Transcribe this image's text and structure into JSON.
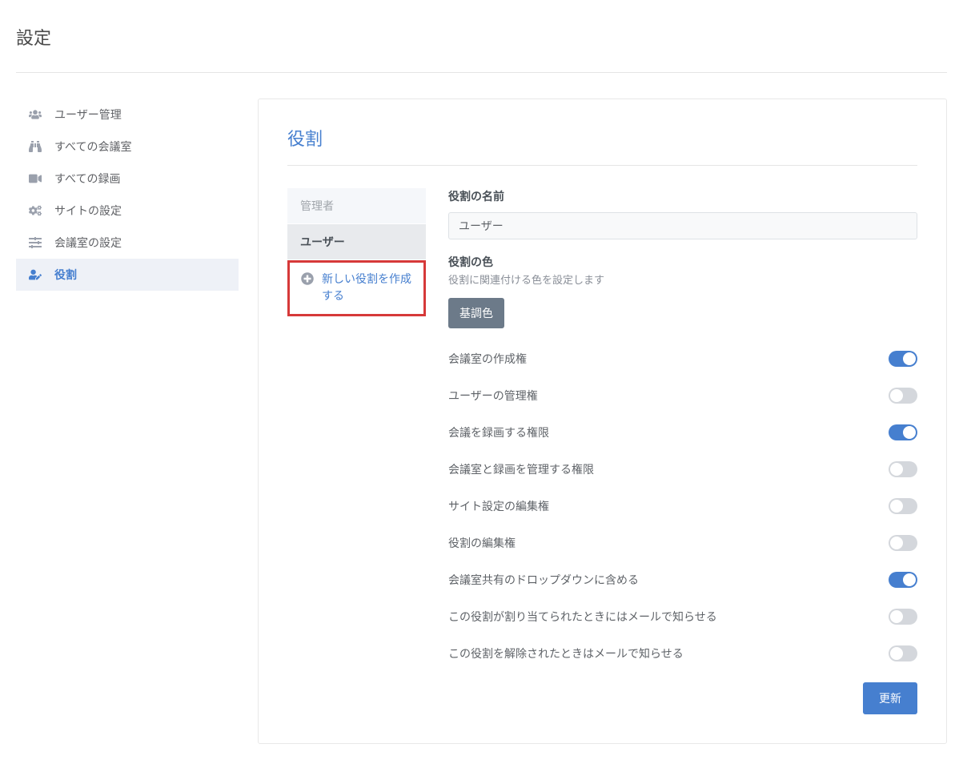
{
  "page": {
    "title": "設定"
  },
  "sidebar": {
    "items": [
      {
        "label": "ユーザー管理",
        "icon": "users-icon"
      },
      {
        "label": "すべての会議室",
        "icon": "binoculars-icon"
      },
      {
        "label": "すべての録画",
        "icon": "video-icon"
      },
      {
        "label": "サイトの設定",
        "icon": "cogs-icon"
      },
      {
        "label": "会議室の設定",
        "icon": "sliders-icon"
      },
      {
        "label": "役割",
        "icon": "user-edit-icon"
      }
    ]
  },
  "panel": {
    "title": "役割",
    "roleTabs": {
      "admin": "管理者",
      "user": "ユーザー",
      "createNew": "新しい役割を作成する"
    },
    "form": {
      "nameLabel": "役割の名前",
      "nameValue": "ユーザー",
      "colorLabel": "役割の色",
      "colorHelp": "役割に関連付ける色を設定します",
      "colorButton": "基調色",
      "permissions": [
        {
          "label": "会議室の作成権",
          "on": true
        },
        {
          "label": "ユーザーの管理権",
          "on": false
        },
        {
          "label": "会議を録画する権限",
          "on": true
        },
        {
          "label": "会議室と録画を管理する権限",
          "on": false
        },
        {
          "label": "サイト設定の編集権",
          "on": false
        },
        {
          "label": "役割の編集権",
          "on": false
        },
        {
          "label": "会議室共有のドロップダウンに含める",
          "on": true
        },
        {
          "label": "この役割が割り当てられたときにはメールで知らせる",
          "on": false
        },
        {
          "label": "この役割を解除されたときはメールで知らせる",
          "on": false
        }
      ],
      "submit": "更新"
    }
  }
}
